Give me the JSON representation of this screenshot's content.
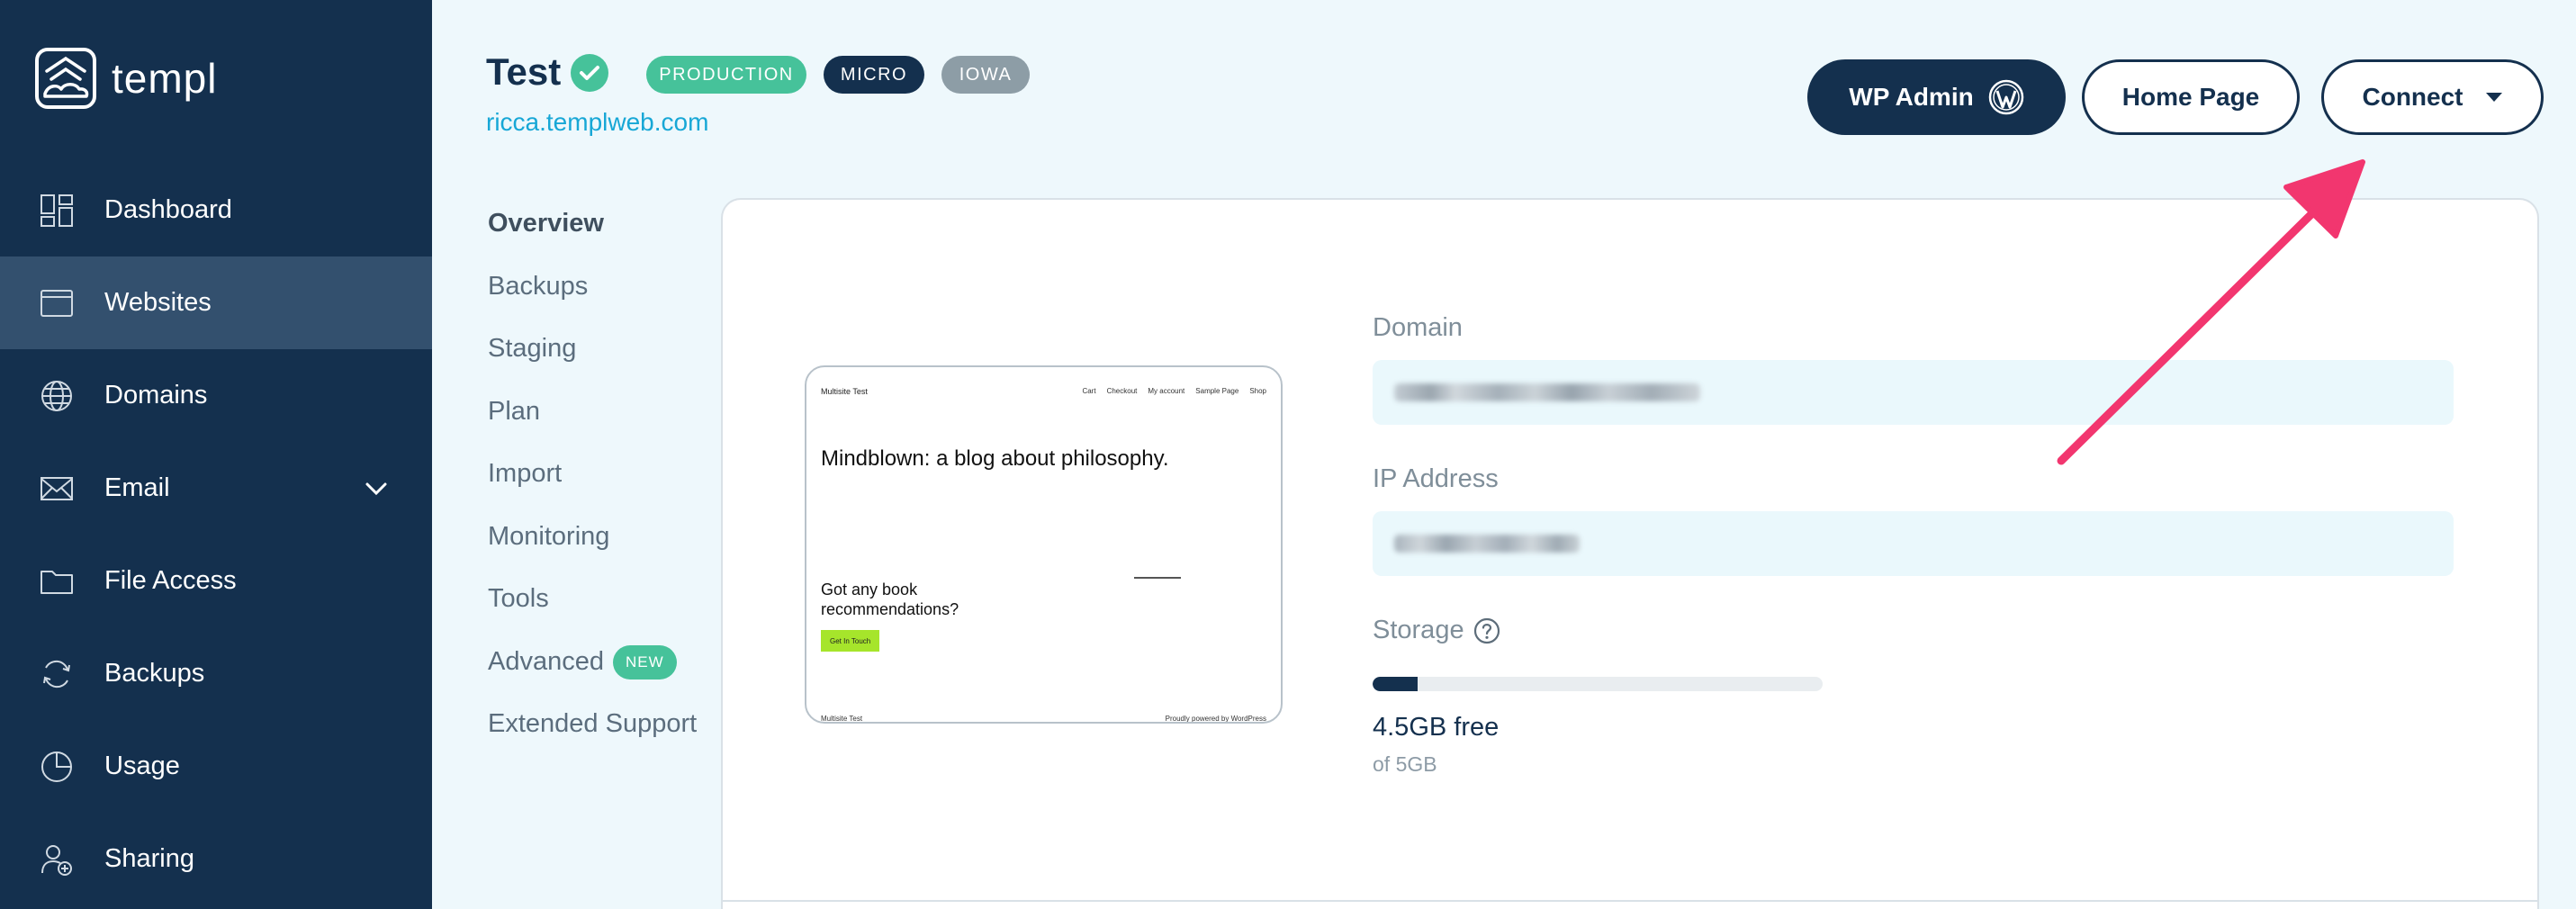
{
  "brand": {
    "name": "templ"
  },
  "sidebar": {
    "items": [
      {
        "label": "Dashboard",
        "icon": "dashboard-icon"
      },
      {
        "label": "Websites",
        "icon": "browser-window-icon",
        "active": true
      },
      {
        "label": "Domains",
        "icon": "globe-icon"
      },
      {
        "label": "Email",
        "icon": "envelope-icon",
        "expandable": true
      },
      {
        "label": "File Access",
        "icon": "folder-icon"
      },
      {
        "label": "Backups",
        "icon": "refresh-icon"
      },
      {
        "label": "Usage",
        "icon": "pie-chart-icon"
      },
      {
        "label": "Sharing",
        "icon": "user-add-icon"
      }
    ]
  },
  "header": {
    "title": "Test",
    "tags": [
      "PRODUCTION",
      "MICRO",
      "IOWA"
    ],
    "url": "ricca.templweb.com",
    "buttons": {
      "wp_admin": "WP Admin",
      "home_page": "Home Page",
      "connect": "Connect"
    }
  },
  "subnav": {
    "items": [
      "Overview",
      "Backups",
      "Staging",
      "Plan",
      "Import",
      "Monitoring",
      "Tools",
      "Advanced",
      "Extended Support"
    ],
    "new_badge": "NEW"
  },
  "preview": {
    "site_name": "Multisite Test",
    "menu": [
      "Cart",
      "Checkout",
      "My account",
      "Sample Page",
      "Shop"
    ],
    "headline": "Mindblown: a blog about philosophy.",
    "book_text": "Got any book recommendations?",
    "cta": "Get In Touch",
    "footer_left": "Multisite Test",
    "footer_right": "Proudly powered by WordPress"
  },
  "details": {
    "domain_label": "Domain",
    "ip_label": "IP Address",
    "storage_label": "Storage",
    "storage_free": "4.5GB free",
    "storage_total": "of 5GB",
    "storage_used_fraction": 0.1
  },
  "colors": {
    "sidebar": "#14304e",
    "sidebar_active": "#33506e",
    "accent_green": "#46c29a",
    "link": "#17a7d6",
    "annotation_arrow": "#f2366f"
  }
}
